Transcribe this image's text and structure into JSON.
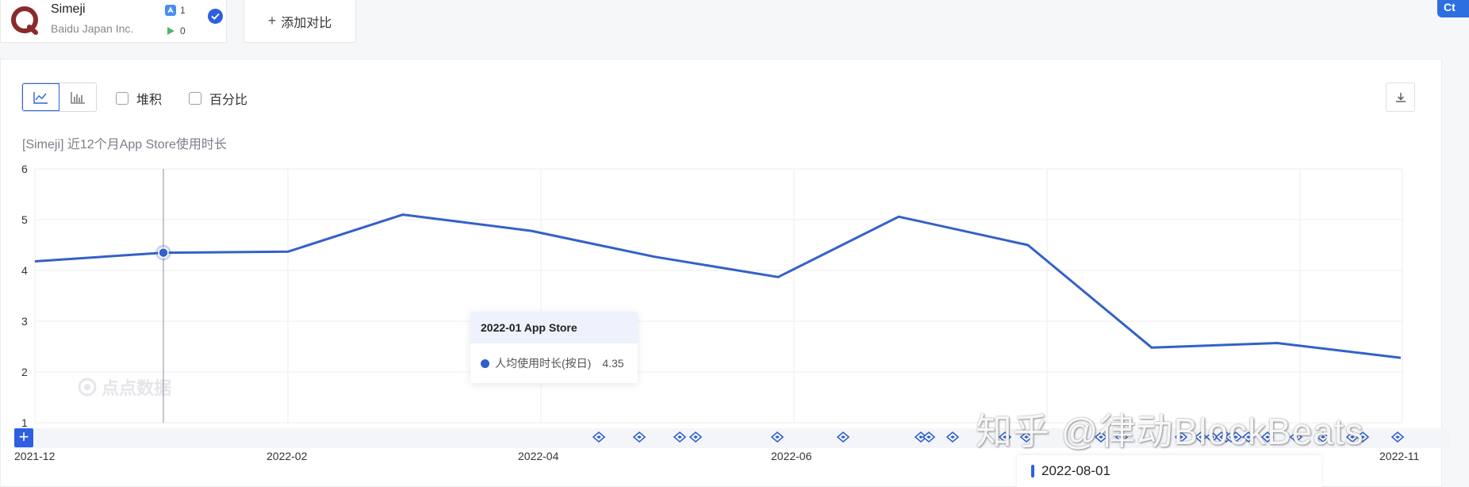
{
  "app": {
    "name": "Simeji",
    "developer": "Baidu Japan Inc.",
    "appstore_count": "1",
    "googleplay_count": "0",
    "brand_color": "#8a2b2b"
  },
  "header": {
    "add_compare_label": "添加对比",
    "corner_label": "Ct"
  },
  "toolbar": {
    "chart_types": [
      "line-chart-icon",
      "bar-chart-icon"
    ],
    "stack_label": "堆积",
    "percent_label": "百分比",
    "download_icon": "download-icon"
  },
  "chart_title": "[Simeji]  近12个月App Store使用时长",
  "tooltip": {
    "title": "2022-01 App Store",
    "series_label": "人均使用时长(按日)",
    "value": "4.35"
  },
  "watermark_chart": "点点数据",
  "watermark_zhihu": "知乎 @律动BlockBeats",
  "date_popup": "2022-08-01",
  "colors": {
    "accent": "#2d5fe0",
    "line": "#3461c8"
  },
  "chart_data": {
    "type": "line",
    "title": "[Simeji]  近12个月App Store使用时长",
    "x": [
      "2021-12",
      "2022-01",
      "2022-02",
      "2022-03",
      "2022-04",
      "2022-05",
      "2022-06",
      "2022-07",
      "2022-08",
      "2022-09",
      "2022-10",
      "2022-11"
    ],
    "x_tick_labels": [
      "2021-12",
      "2022-02",
      "2022-04",
      "2022-06",
      "2022-11"
    ],
    "y_ticks": [
      "1",
      "2",
      "3",
      "4",
      "5",
      "6"
    ],
    "ylim": [
      1,
      6
    ],
    "series": [
      {
        "name": "人均使用时长(按日)",
        "values": [
          4.18,
          4.35,
          4.37,
          5.1,
          4.78,
          4.27,
          3.87,
          5.06,
          4.5,
          2.48,
          2.57,
          2.28
        ]
      }
    ],
    "highlight_index": 1,
    "grid": true,
    "event_marker_count": 27
  }
}
